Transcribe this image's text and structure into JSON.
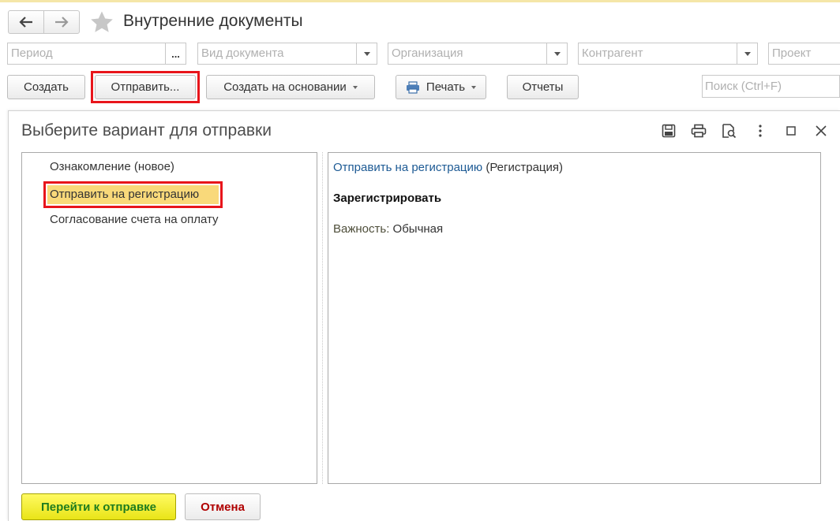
{
  "window": {
    "title": "Внутренние документы"
  },
  "filters": {
    "period_placeholder": "Период",
    "period_button": "...",
    "doc_type_placeholder": "Вид документа",
    "org_placeholder": "Организация",
    "counterparty_placeholder": "Контрагент",
    "project_placeholder": "Проект"
  },
  "toolbar": {
    "create": "Создать",
    "send": "Отправить...",
    "create_based": "Создать на основании",
    "print": "Печать",
    "reports": "Отчеты",
    "search_placeholder": "Поиск (Ctrl+F)"
  },
  "dialog": {
    "title": "Выберите вариант для отправки",
    "options": [
      "Ознакомление (новое)",
      "Отправить на регистрацию",
      "Согласование счета на оплату"
    ],
    "selected_index": 1,
    "detail": {
      "link_text": "Отправить на регистрацию",
      "link_suffix": "(Регистрация)",
      "action": "Зарегистрировать",
      "importance_label": "Важность:",
      "importance_value": "Обычная"
    },
    "go_button": "Перейти к отправке",
    "cancel_button": "Отмена"
  },
  "colors": {
    "highlight_red": "#e8151b",
    "selected_row": "#f9d97a",
    "primary_button": "#f4ef3a",
    "link": "#1d5a94"
  },
  "icons": [
    "back-arrow-icon",
    "forward-arrow-icon",
    "star-icon",
    "printer-icon",
    "save-icon",
    "preview-icon",
    "more-icon",
    "maximize-icon",
    "close-icon"
  ]
}
